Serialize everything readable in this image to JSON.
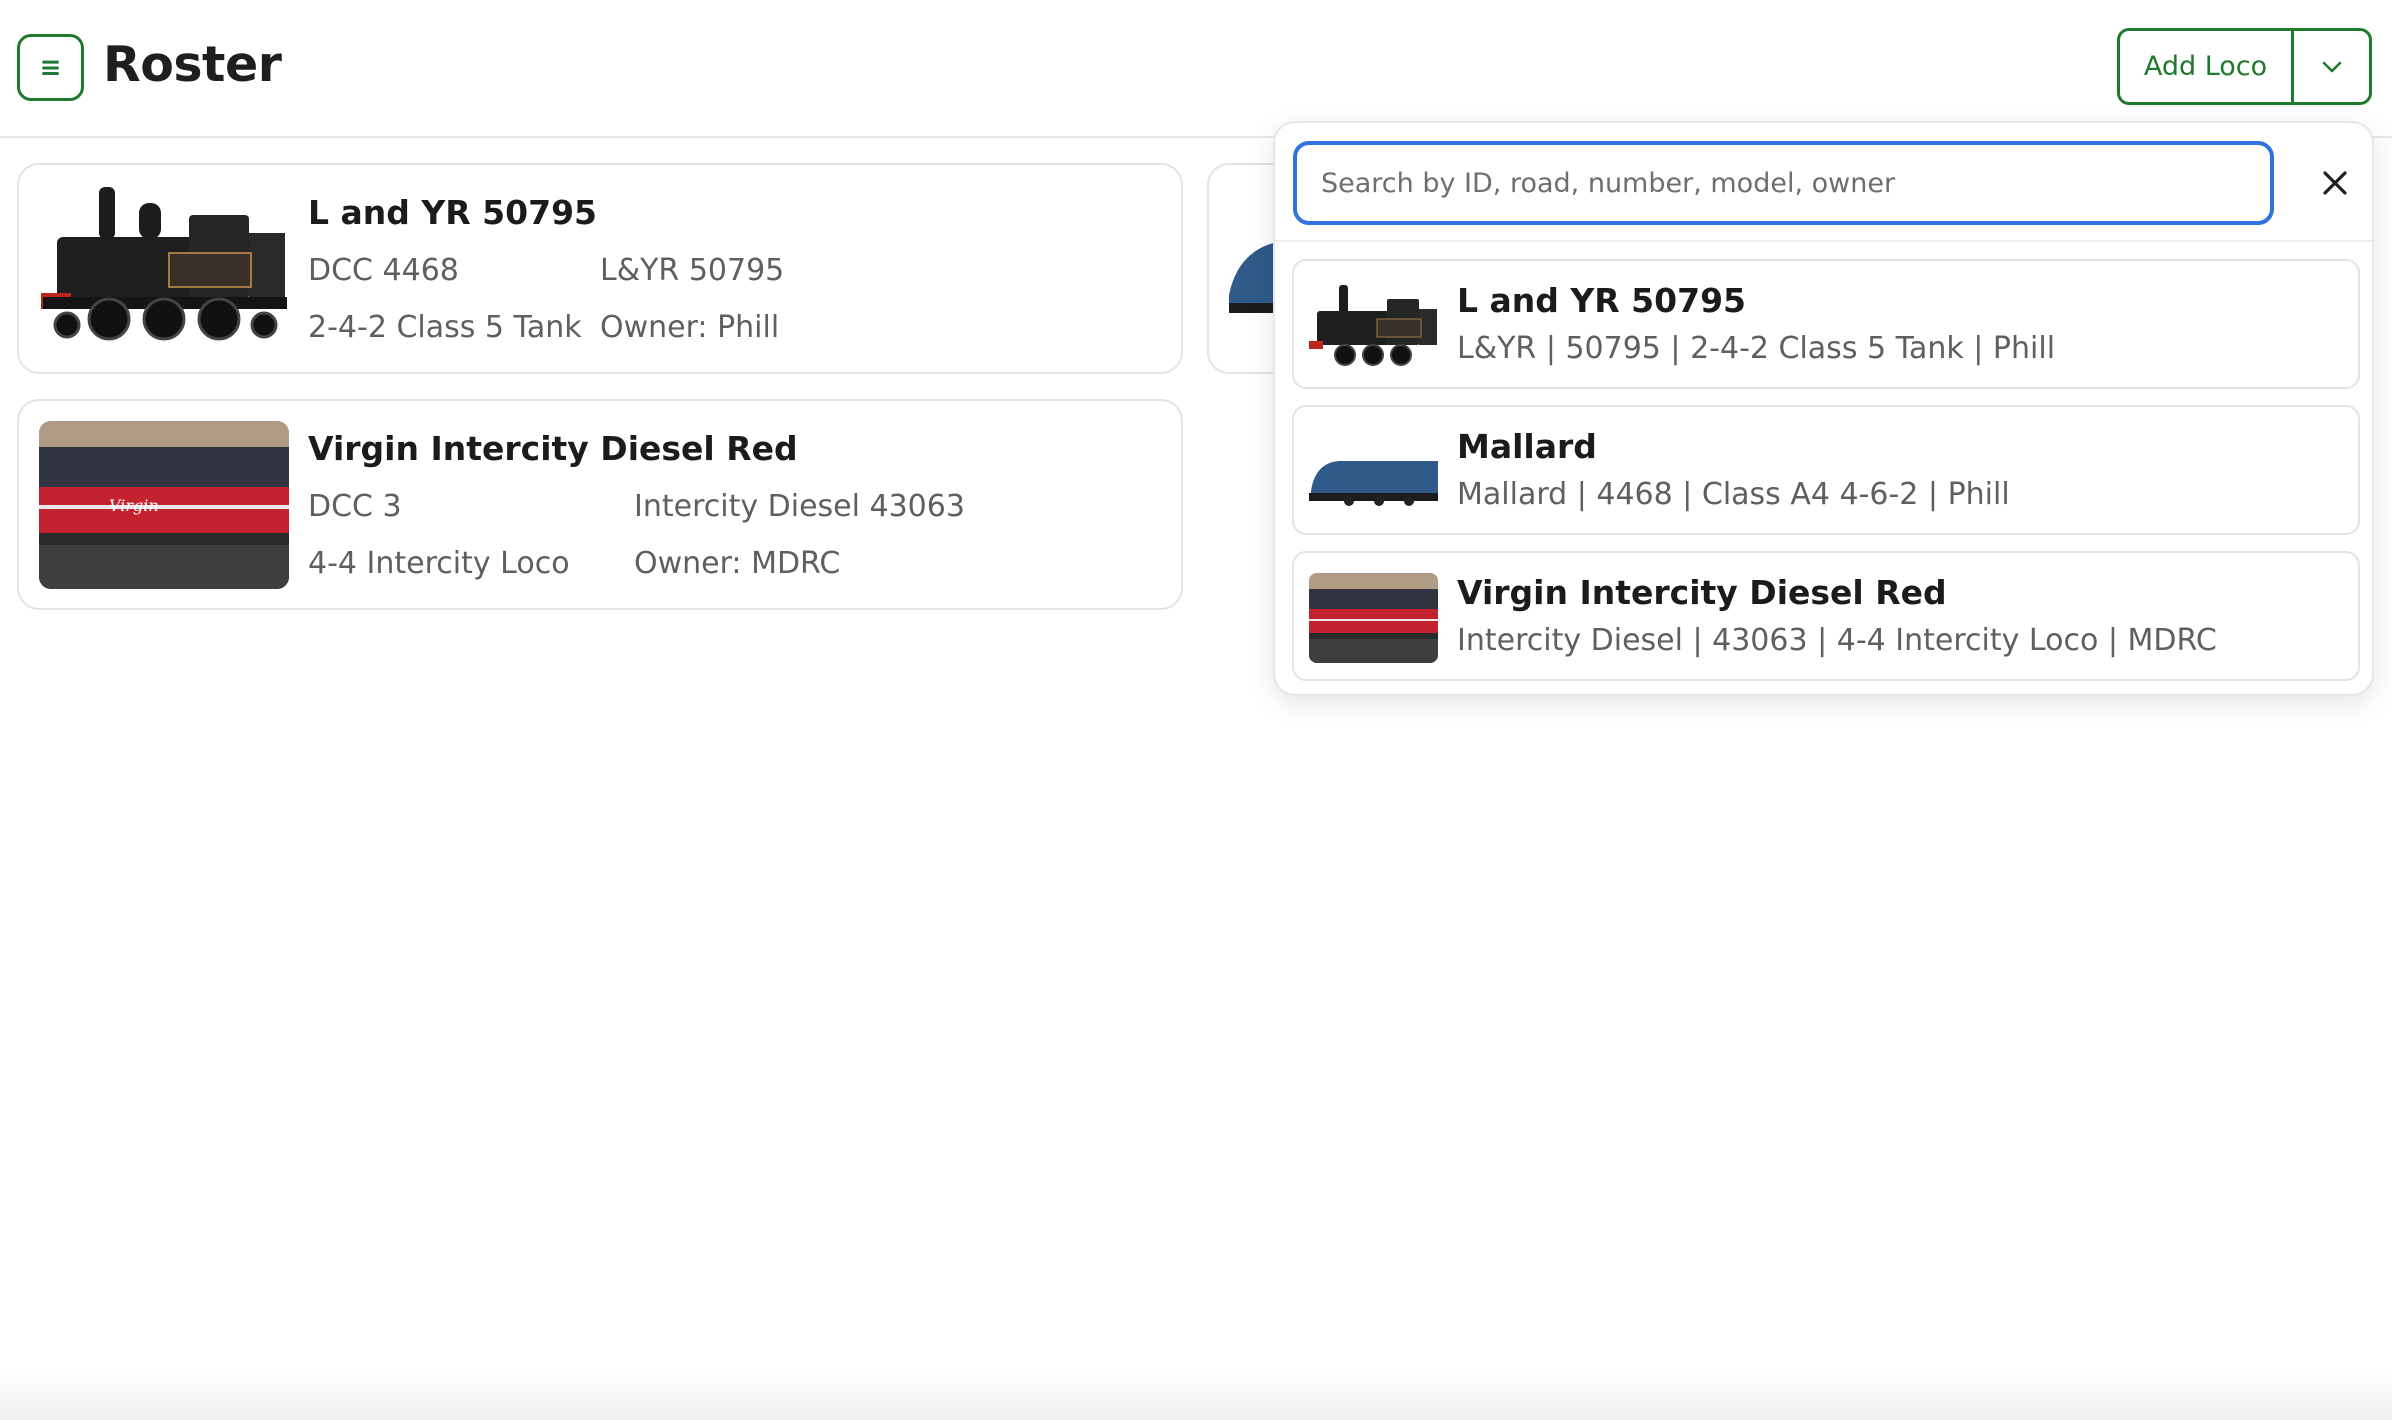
{
  "header": {
    "title": "Roster",
    "menu_icon_glyph": "≡",
    "add_label": "Add Loco",
    "accent": "#1f7a2e"
  },
  "roster": [
    {
      "name": "L and YR 50795",
      "dcc": "DCC 4468",
      "road": "L&YR 50795",
      "model": "2-4-2 Class 5 Tank",
      "owner": "Owner: Phill",
      "image": "black-steam-tank-loco"
    },
    {
      "name": "Virgin Intercity Diesel Red",
      "dcc": "DCC 3",
      "road": "Intercity Diesel 43063",
      "model": "4-4 Intercity Loco",
      "owner": "Owner: MDRC",
      "image": "virgin-red-diesel"
    }
  ],
  "search": {
    "placeholder": "Search by ID, road, number, model, owner",
    "value": "",
    "results": [
      {
        "name": "L and YR 50795",
        "details": "L&YR | 50795 | 2-4-2 Class 5 Tank | Phill",
        "image": "black-steam-tank-loco"
      },
      {
        "name": "Mallard",
        "details": "Mallard | 4468 | Class A4 4-6-2 | Phill",
        "image": "blue-a4-streamliner"
      },
      {
        "name": "Virgin Intercity Diesel Red",
        "details": "Intercity Diesel | 43063 | 4-4 Intercity Loco | MDRC",
        "image": "virgin-red-diesel"
      }
    ]
  },
  "colors": {
    "accent_green": "#1f7a2e",
    "focus_blue": "#2e73e0",
    "border": "#e3e3e3"
  }
}
